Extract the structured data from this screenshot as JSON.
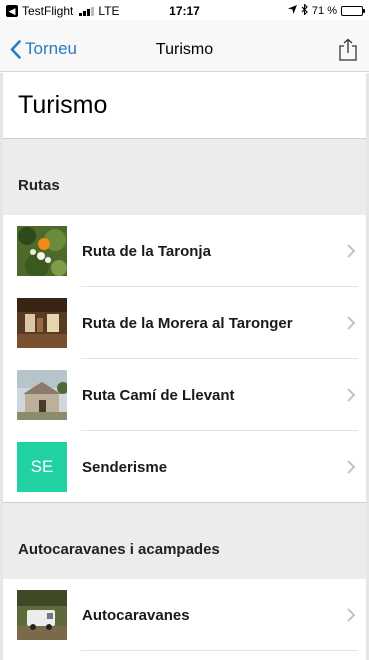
{
  "status_bar": {
    "carrier": "TestFlight",
    "network": "LTE",
    "time": "17:17",
    "battery": "71 %",
    "battery_level": 0.71
  },
  "nav": {
    "back_label": "Torneu",
    "title": "Turismo"
  },
  "page": {
    "title": "Turismo"
  },
  "sections": [
    {
      "title": "Rutas",
      "items": [
        {
          "label": "Ruta de la Taronja",
          "thumb": "orange-tree-photo"
        },
        {
          "label": "Ruta de la Morera al Taronger",
          "thumb": "interior-photo"
        },
        {
          "label": "Ruta Camí de Llevant",
          "thumb": "chapel-photo"
        },
        {
          "label": "Senderisme",
          "thumb_text": "SE",
          "thumb_color": "#1fd1a3"
        }
      ]
    },
    {
      "title": "Autocaravanes i acampades",
      "items": [
        {
          "label": "Autocaravanes",
          "thumb": "camper-photo"
        }
      ]
    }
  ],
  "colors": {
    "accent": "#2a7ac4",
    "section_bg": "#ececec"
  }
}
